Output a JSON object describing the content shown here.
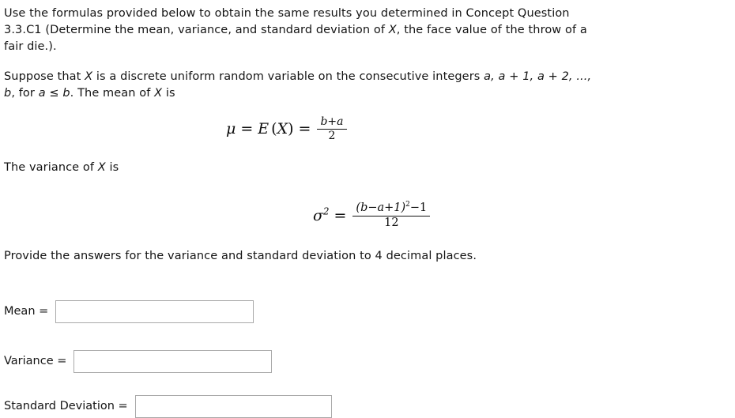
{
  "problem": {
    "intro_line_1": "Use the formulas provided below to obtain the same results you determined in Concept Question",
    "intro_line_2_a": "3.3.C1 (Determine the mean, variance, and standard deviation of ",
    "intro_line_2_var": "X",
    "intro_line_2_b": ", the face value of the throw of a",
    "intro_line_3": "fair die.).",
    "setup_a": "Suppose that ",
    "setup_var_x": "X",
    "setup_b": " is a discrete uniform random variable on the consecutive integers ",
    "setup_seq": "a, a + 1, a + 2, ...,",
    "setup_c": "b",
    "setup_d": ", for ",
    "setup_cond": "a ≤ b",
    "setup_e": ". The mean of ",
    "setup_var_x2": "X",
    "setup_f": " is",
    "variance_lead_a": "The variance of ",
    "variance_lead_var": "X",
    "variance_lead_b": " is",
    "instructions": "Provide the answers for the variance and standard deviation to 4 decimal places."
  },
  "formulas": {
    "mean": {
      "mu": "μ",
      "equals_1": "=",
      "expectation": "E",
      "paren_open": "(",
      "random_var": "X",
      "paren_close": ")",
      "equals_2": "=",
      "numerator": "b+a",
      "denominator": "2"
    },
    "variance": {
      "sigma": "σ",
      "sigma_exponent": "2",
      "equals": "=",
      "numerator_base": "(b−a+1)",
      "numerator_exponent": "2",
      "numerator_tail": "−1",
      "denominator": "12"
    }
  },
  "answers": {
    "mean": {
      "label": "Mean =",
      "value": "",
      "placeholder": ""
    },
    "variance": {
      "label": "Variance =",
      "value": "",
      "placeholder": ""
    },
    "standard_deviation": {
      "label": "Standard Deviation =",
      "value": "",
      "placeholder": ""
    }
  },
  "colors": {
    "background": "#ffffff",
    "text": "#141414",
    "input_border": "#a9a9a9"
  }
}
